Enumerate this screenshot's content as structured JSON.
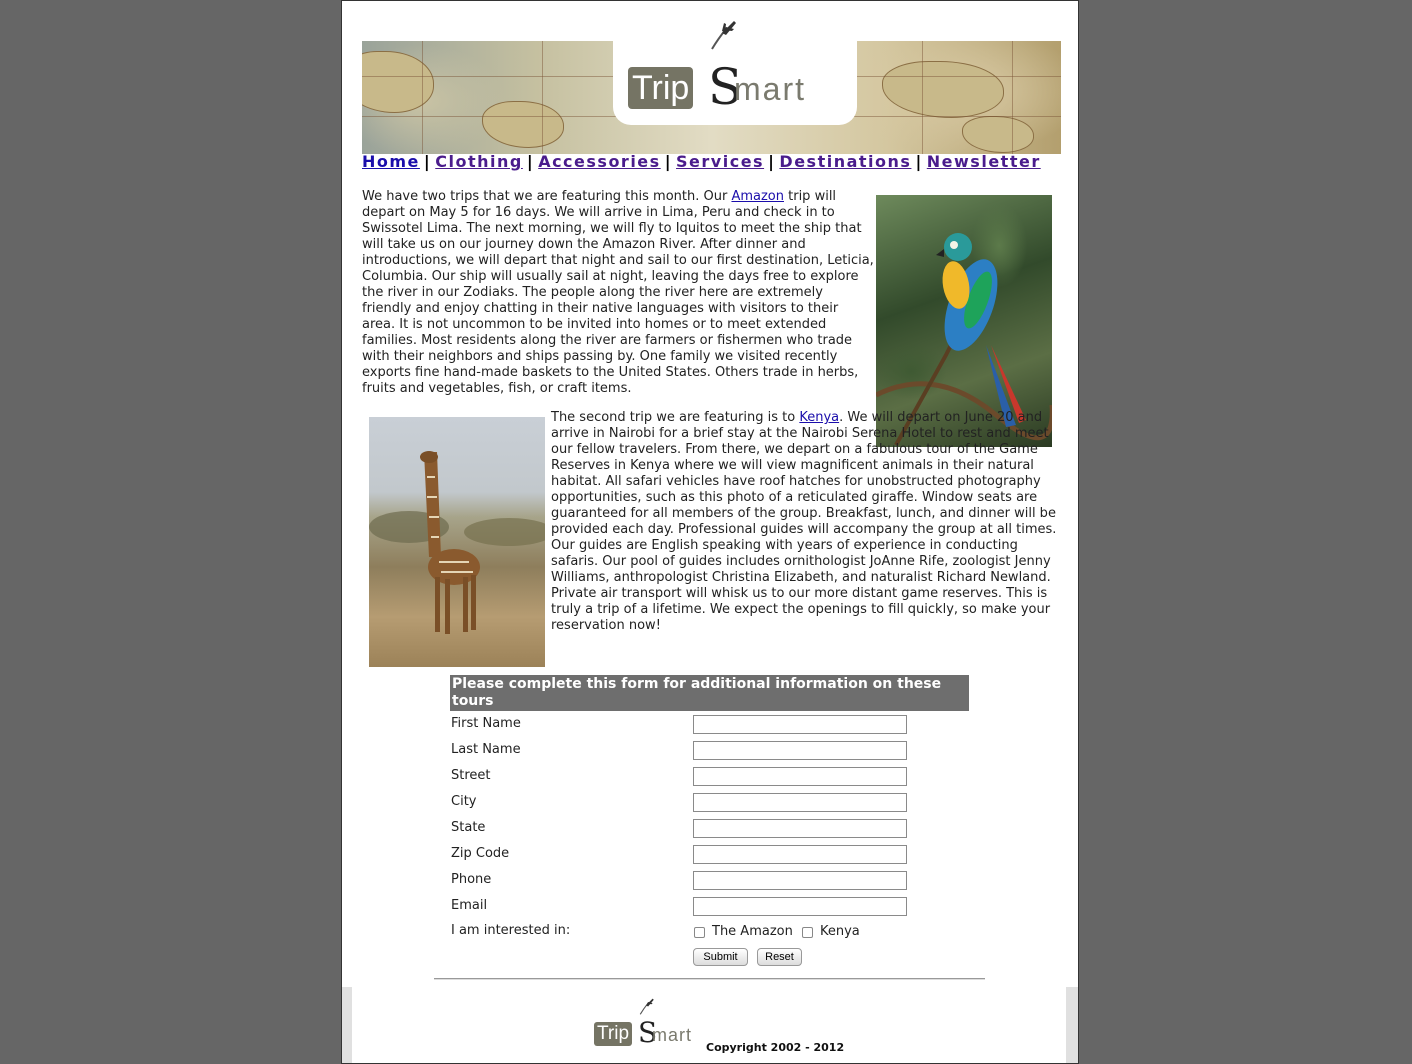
{
  "brand": {
    "trip": "Trip",
    "s": "S",
    "mart": "mart"
  },
  "nav": {
    "items": [
      "Home",
      "Clothing",
      "Accessories",
      "Services",
      "Destinations",
      "Newsletter"
    ],
    "separator": "|"
  },
  "content": {
    "p1_before": "We have two trips that we are featuring this month. Our ",
    "p1_link": "Amazon",
    "p1_after": " trip will depart on May 5 for 16 days. We will arrive in Lima, Peru and check in to Swissotel Lima. The next morning, we will fly to Iquitos to meet the ship that will take us on our journey down the Amazon River. After dinner and introductions, we will depart that night and sail to our first destination, Leticia, Columbia. Our ship will usually sail at night, leaving the days free to explore the river in our Zodiaks. The people along the river here are extremely friendly and enjoy chatting in their native languages with visitors to their area. It is not uncommon to be invited into homes or to meet extended families. Most residents along the river are farmers or fishermen who trade with their neighbors and ships passing by. One family we visited recently exports fine hand-made baskets to the United States. Others trade in herbs, fruits and vegetables, fish, or craft items.",
    "p2_before": "The second trip we are featuring is to ",
    "p2_link": "Kenya",
    "p2_after": ". We will depart on June 20 and arrive in Nairobi for a brief stay at the Nairobi Serena Hotel to rest and meet our fellow travelers. From there, we depart on a fabulous tour of the Game Reserves in Kenya where we will view magnificent animals in their natural habitat. All safari vehicles have roof hatches for unobstructed photography opportunities, such as this photo of a reticulated giraffe. Window seats are guaranteed for all members of the group. Breakfast, lunch, and dinner will be provided each day. Professional guides will accompany the group at all times. Our guides are English speaking with years of experience in conducting safaris. Our pool of guides includes ornithologist JoAnne Rife, zoologist Jenny Williams, anthropologist Christina Elizabeth, and naturalist Richard Newland. Private air transport will whisk us to our more distant game reserves. This is truly a trip of a lifetime. We expect the openings to fill quickly, so make your reservation now!"
  },
  "form": {
    "header": "Please complete this form for additional information on these tours",
    "fields": [
      {
        "label": "First Name",
        "value": ""
      },
      {
        "label": "Last Name",
        "value": ""
      },
      {
        "label": "Street",
        "value": ""
      },
      {
        "label": "City",
        "value": ""
      },
      {
        "label": "State",
        "value": ""
      },
      {
        "label": "Zip Code",
        "value": ""
      },
      {
        "label": "Phone",
        "value": ""
      },
      {
        "label": "Email",
        "value": ""
      }
    ],
    "interest_label": "I am interested in:",
    "options": [
      {
        "label": "The Amazon",
        "checked": false
      },
      {
        "label": "Kenya",
        "checked": false
      }
    ],
    "submit": "Submit",
    "reset": "Reset"
  },
  "footer": {
    "copyright": "Copyright 2002 - 2012"
  },
  "colors": {
    "background": "#666666",
    "link": "#1a0dab",
    "form_header": "#6e6e6e",
    "logo_box": "#757464"
  }
}
